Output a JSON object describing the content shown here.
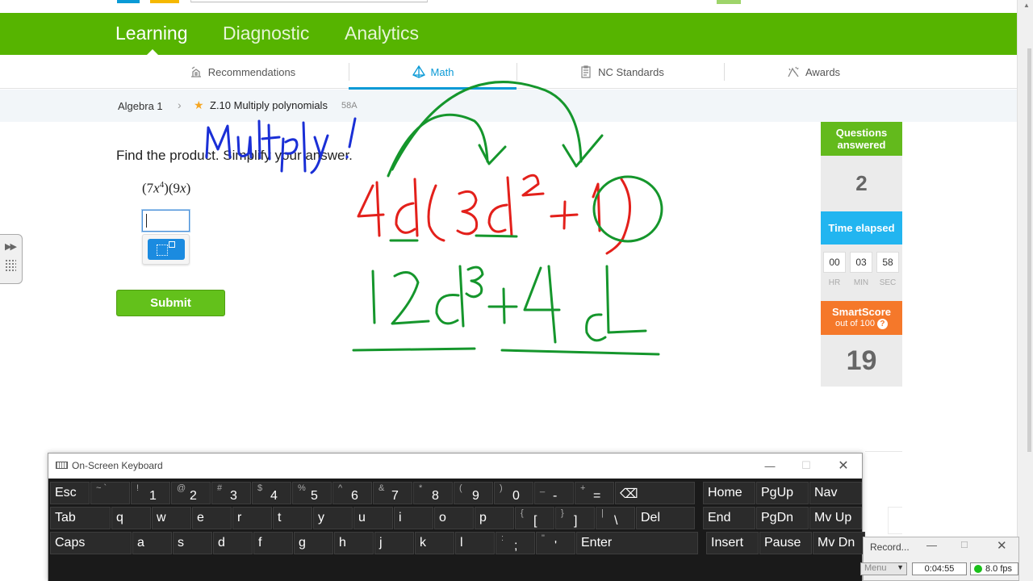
{
  "nav": {
    "items": [
      "Learning",
      "Diagnostic",
      "Analytics"
    ],
    "active": "Learning",
    "color": "#56b400"
  },
  "subtabs": {
    "recommendations": "Recommendations",
    "math": "Math",
    "nc_standards": "NC Standards",
    "awards": "Awards",
    "accent": "#0a9ad6"
  },
  "breadcrumb": {
    "course": "Algebra 1",
    "skill": "Z.10 Multiply polynomials",
    "code": "58A"
  },
  "question": {
    "prompt": "Find the product. Simplify your answer.",
    "expression": {
      "a": "(7",
      "var1": "x",
      "exp1": "4",
      "b": ")(9",
      "var2": "x",
      "c": ")"
    },
    "answer_value": "",
    "submit_label": "Submit"
  },
  "stats": {
    "questions_answered_label": "Questions answered",
    "questions_answered": "2",
    "time_elapsed_label": "Time elapsed",
    "time": {
      "hr": "00",
      "min": "03",
      "sec": "58"
    },
    "time_units": {
      "hr": "HR",
      "min": "MIN",
      "sec": "SEC"
    },
    "smartscore_label": "SmartScore",
    "smartscore_sub": "out of 100",
    "smartscore_help": "?",
    "smartscore": "19",
    "colors": {
      "answered": "#63ba1c",
      "time": "#22b5f0",
      "smartscore": "#f5782a"
    }
  },
  "annotations": {
    "note": "Multiply!",
    "problem": "4d(3d²+1)",
    "result": "12d³+4d",
    "colors": {
      "blue": "#1a2fd6",
      "red": "#e3201b",
      "green": "#15962c"
    }
  },
  "keyboard": {
    "title": "On-Screen Keyboard",
    "row1": [
      {
        "l": "Esc"
      },
      {
        "s": "~ `",
        "m": ""
      },
      {
        "s": "!",
        "m": "1"
      },
      {
        "s": "@",
        "m": "2"
      },
      {
        "s": "#",
        "m": "3"
      },
      {
        "s": "$",
        "m": "4"
      },
      {
        "s": "%",
        "m": "5"
      },
      {
        "s": "^",
        "m": "6"
      },
      {
        "s": "&",
        "m": "7"
      },
      {
        "s": "*",
        "m": "8"
      },
      {
        "s": "(",
        "m": "9"
      },
      {
        "s": ")",
        "m": "0"
      },
      {
        "s": "_",
        "m": "-"
      },
      {
        "s": "+",
        "m": "="
      },
      {
        "l": "⌫"
      },
      {
        "l": "Home"
      },
      {
        "l": "PgUp"
      },
      {
        "l": "Nav"
      }
    ],
    "row2": [
      {
        "l": "Tab"
      },
      {
        "l": "q"
      },
      {
        "l": "w"
      },
      {
        "l": "e"
      },
      {
        "l": "r"
      },
      {
        "l": "t"
      },
      {
        "l": "y"
      },
      {
        "l": "u"
      },
      {
        "l": "i"
      },
      {
        "l": "o"
      },
      {
        "l": "p"
      },
      {
        "s": "{",
        "m": "["
      },
      {
        "s": "}",
        "m": "]"
      },
      {
        "s": "|",
        "m": "\\"
      },
      {
        "l": "Del"
      },
      {
        "l": "End"
      },
      {
        "l": "PgDn"
      },
      {
        "l": "Mv Up"
      }
    ],
    "row3": [
      {
        "l": "Caps"
      },
      {
        "l": "a"
      },
      {
        "l": "s"
      },
      {
        "l": "d"
      },
      {
        "l": "f"
      },
      {
        "l": "g"
      },
      {
        "l": "h"
      },
      {
        "l": "j"
      },
      {
        "l": "k"
      },
      {
        "l": "l"
      },
      {
        "s": ":",
        "m": ";"
      },
      {
        "s": "\"",
        "m": "'"
      },
      {
        "l": "Enter"
      },
      {
        "l": "Insert"
      },
      {
        "l": "Pause"
      },
      {
        "l": "Mv Dn"
      }
    ]
  },
  "recorder": {
    "title": "Record...",
    "menu": "Menu",
    "elapsed": "0:04:55",
    "fps": "8.0 fps"
  }
}
